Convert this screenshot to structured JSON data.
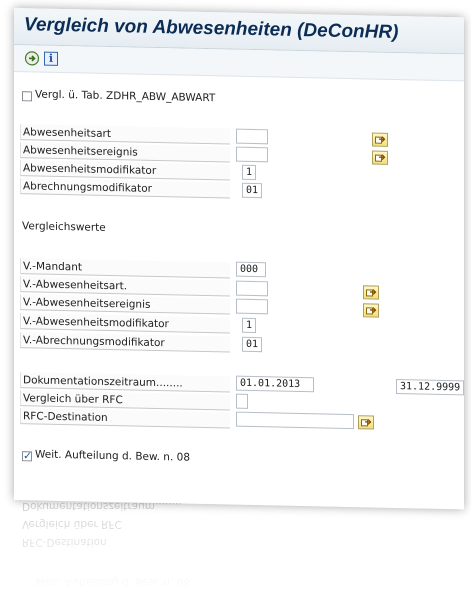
{
  "window": {
    "title": "Vergleich von Abwesenheiten (DeConHR)"
  },
  "toolbar": {
    "icons": [
      "execute-icon",
      "info-icon"
    ],
    "info_glyph": "i"
  },
  "top_checkbox": {
    "label": "Vergl. ü. Tab. ZDHR_ABW_ABWART",
    "checked": false
  },
  "main_fields": [
    {
      "label": "Abwesenheitsart",
      "value": ""
    },
    {
      "label": "Abwesenheitsereignis",
      "value": ""
    },
    {
      "label": "Abwesenheitsmodifikator",
      "value": "1"
    },
    {
      "label": "Abrechnungsmodifikator",
      "value": "01"
    }
  ],
  "compare_section": {
    "title": "Vergleichswerte",
    "fields": [
      {
        "label": "V.-Mandant",
        "value": "000"
      },
      {
        "label": "V.-Abwesenheitsart.",
        "value": ""
      },
      {
        "label": "V.-Abwesenheitsereignis",
        "value": ""
      },
      {
        "label": "V.-Abwesenheitsmodifikator",
        "value": "1"
      },
      {
        "label": "V.-Abrechnungsmodifikator",
        "value": "01"
      }
    ]
  },
  "doc_period": {
    "label": "Dokumentationszeitraum........",
    "from": "01.01.2013",
    "to": "31.12.9999"
  },
  "rfc": {
    "compare_label": "Vergleich über RFC",
    "compare_value": "",
    "destination_label": "RFC-Destination",
    "destination_value": ""
  },
  "bottom_checkbox": {
    "label": "Weit. Aufteilung d. Bew. n. 08",
    "checked": true,
    "check_glyph": "✓"
  },
  "colors": {
    "title": "#0b2d55",
    "picker_button": "#f2df78",
    "check_mark": "#1b5fb5"
  }
}
